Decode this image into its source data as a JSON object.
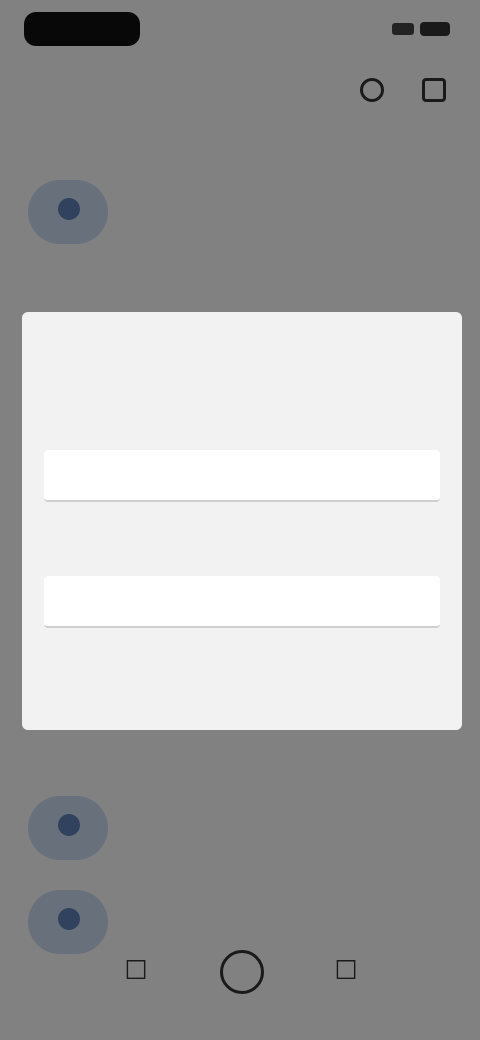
{
  "status": {
    "time": ""
  },
  "header": {
    "title": "",
    "subtitle": ""
  },
  "contacts": [
    {
      "name": "",
      "detail": ""
    },
    {
      "name": "",
      "detail": ""
    },
    {
      "name": "",
      "detail": ""
    }
  ],
  "dialog": {
    "title": "",
    "field1": {
      "label": "",
      "value": ""
    },
    "field2": {
      "label": "",
      "value": ""
    },
    "cancel": "",
    "ok": ""
  },
  "colors": {
    "accent": "#4a78c8",
    "scrim": "#000000"
  }
}
